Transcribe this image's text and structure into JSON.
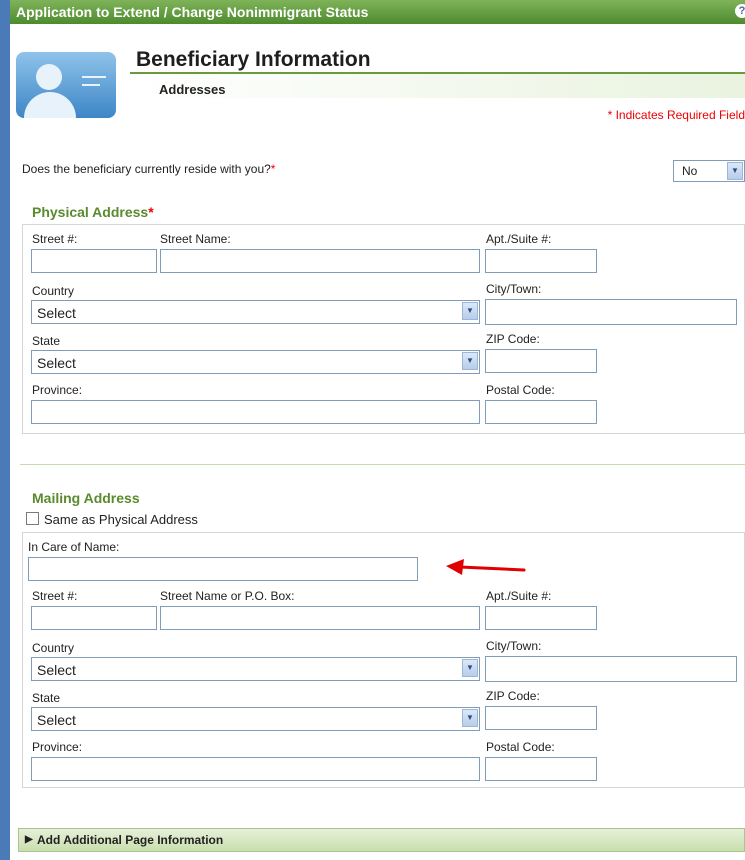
{
  "window": {
    "title": "Application to Extend / Change Nonimmigrant Status",
    "help_glyph": "?"
  },
  "header": {
    "title": "Beneficiary Information",
    "subtitle": "Addresses",
    "required_note": "* Indicates Required Field"
  },
  "question": {
    "text": "Does the beneficiary currently reside with you?",
    "required_mark": "*",
    "value": "No"
  },
  "physical": {
    "title": "Physical Address",
    "required_mark": "*",
    "street_no_label": "Street #:",
    "street_name_label": "Street Name:",
    "apt_label": "Apt./Suite #:",
    "country_label": "Country",
    "country_value": "Select",
    "city_label": "City/Town:",
    "state_label": "State",
    "state_value": "Select",
    "zip_label": "ZIP Code:",
    "province_label": "Province:",
    "postal_label": "Postal Code:"
  },
  "mailing": {
    "title": "Mailing Address",
    "same_as_label": "Same as Physical Address",
    "care_of_label": "In Care of Name:",
    "street_no_label": "Street #:",
    "street_name_label": "Street Name or P.O. Box:",
    "apt_label": "Apt./Suite #:",
    "country_label": "Country",
    "country_value": "Select",
    "city_label": "City/Town:",
    "state_label": "State",
    "state_value": "Select",
    "zip_label": "ZIP Code:",
    "province_label": "Province:",
    "postal_label": "Postal Code:"
  },
  "footer": {
    "label": "Add Additional Page Information"
  },
  "colors": {
    "accent_green": "#5b8a2e",
    "required_red": "#e00000",
    "annotation_arrow": "#e00000"
  },
  "icons": {
    "avatar": "user-profile-icon",
    "dropdown": "chevron-down-icon",
    "expand": "triangle-right-icon",
    "annotation": "arrow-left-icon"
  }
}
